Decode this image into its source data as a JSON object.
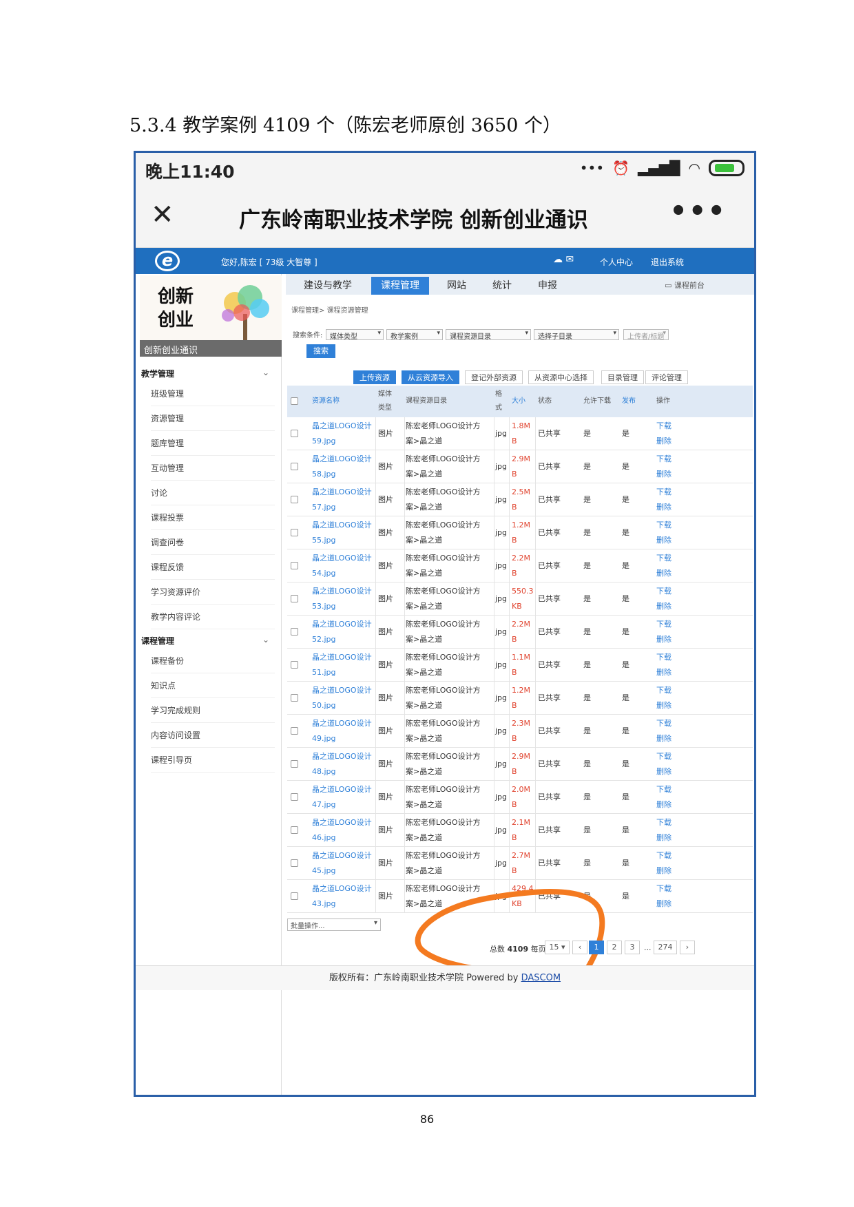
{
  "heading": "5.3.4 教学案例 4109 个（陈宏老师原创 3650 个）",
  "status": {
    "time": "晚上11:40",
    "icons": [
      "more-dots",
      "alarm-icon",
      "signal-icon",
      "wifi-icon",
      "battery-icon"
    ]
  },
  "titlebar": {
    "close": "✕",
    "title": "广东岭南职业技术学院 创新创业通识",
    "more": "•••"
  },
  "topbar": {
    "greeting": "您好,陈宏 [ 73级 大智尊 ]",
    "personal_center": "个人中心",
    "logout": "退出系统"
  },
  "brand": {
    "title_line1": "创新",
    "title_line2": "创业",
    "caption": "创新创业通识"
  },
  "sidebar": {
    "section1": "教学管理",
    "items1": [
      "班级管理",
      "资源管理",
      "题库管理",
      "互动管理",
      "讨论",
      "课程投票",
      "调查问卷",
      "课程反馈",
      "学习资源评价",
      "教学内容评论"
    ],
    "section2": "课程管理",
    "items2": [
      "课程备份",
      "知识点",
      "学习完成规则",
      "内容访问设置",
      "课程引导页"
    ]
  },
  "tabs": {
    "items": [
      "建设与教学",
      "课程管理",
      "网站",
      "统计",
      "申报"
    ],
    "active": "课程管理",
    "front": "课程前台"
  },
  "breadcrumb": "课程管理> 课程资源管理",
  "search": {
    "label": "搜索条件:",
    "media_type": "媒体类型",
    "case": "教学案例",
    "dir": "课程资源目录",
    "subdir": "选择子目录",
    "uploader_placeholder": "上传者/标题",
    "button": "搜索"
  },
  "actions": {
    "upload": "上传资源",
    "import_cloud": "从云资源导入",
    "register_external": "登记外部资源",
    "select_center": "从资源中心选择",
    "dir_manage": "目录管理",
    "comment_manage": "评论管理"
  },
  "table": {
    "headers": {
      "name": "资源名称",
      "media": "媒体类型",
      "dir": "课程资源目录",
      "format": "格式",
      "size": "大小",
      "state": "状态",
      "download": "允许下载",
      "publish": "发布",
      "ops": "操作"
    },
    "rows": [
      {
        "name1": "晶之道LOGO设计",
        "name2": "59.jpg",
        "media": "图片",
        "dir1": "陈宏老师LOGO设计方",
        "dir2": "案>晶之道",
        "format": "jpg",
        "size1": "1.8M",
        "size2": "B",
        "state": "已共享",
        "download": "是",
        "publish": "是",
        "op1": "下载",
        "op2": "删除"
      },
      {
        "name1": "晶之道LOGO设计",
        "name2": "58.jpg",
        "media": "图片",
        "dir1": "陈宏老师LOGO设计方",
        "dir2": "案>晶之道",
        "format": "jpg",
        "size1": "2.9M",
        "size2": "B",
        "state": "已共享",
        "download": "是",
        "publish": "是",
        "op1": "下载",
        "op2": "删除"
      },
      {
        "name1": "晶之道LOGO设计",
        "name2": "57.jpg",
        "media": "图片",
        "dir1": "陈宏老师LOGO设计方",
        "dir2": "案>晶之道",
        "format": "jpg",
        "size1": "2.5M",
        "size2": "B",
        "state": "已共享",
        "download": "是",
        "publish": "是",
        "op1": "下载",
        "op2": "删除"
      },
      {
        "name1": "晶之道LOGO设计",
        "name2": "55.jpg",
        "media": "图片",
        "dir1": "陈宏老师LOGO设计方",
        "dir2": "案>晶之道",
        "format": "jpg",
        "size1": "1.2M",
        "size2": "B",
        "state": "已共享",
        "download": "是",
        "publish": "是",
        "op1": "下载",
        "op2": "删除"
      },
      {
        "name1": "晶之道LOGO设计",
        "name2": "54.jpg",
        "media": "图片",
        "dir1": "陈宏老师LOGO设计方",
        "dir2": "案>晶之道",
        "format": "jpg",
        "size1": "2.2M",
        "size2": "B",
        "state": "已共享",
        "download": "是",
        "publish": "是",
        "op1": "下载",
        "op2": "删除"
      },
      {
        "name1": "晶之道LOGO设计",
        "name2": "53.jpg",
        "media": "图片",
        "dir1": "陈宏老师LOGO设计方",
        "dir2": "案>晶之道",
        "format": "jpg",
        "size1": "550.3",
        "size2": "KB",
        "state": "已共享",
        "download": "是",
        "publish": "是",
        "op1": "下载",
        "op2": "删除"
      },
      {
        "name1": "晶之道LOGO设计",
        "name2": "52.jpg",
        "media": "图片",
        "dir1": "陈宏老师LOGO设计方",
        "dir2": "案>晶之道",
        "format": "jpg",
        "size1": "2.2M",
        "size2": "B",
        "state": "已共享",
        "download": "是",
        "publish": "是",
        "op1": "下载",
        "op2": "删除"
      },
      {
        "name1": "晶之道LOGO设计",
        "name2": "51.jpg",
        "media": "图片",
        "dir1": "陈宏老师LOGO设计方",
        "dir2": "案>晶之道",
        "format": "jpg",
        "size1": "1.1M",
        "size2": "B",
        "state": "已共享",
        "download": "是",
        "publish": "是",
        "op1": "下载",
        "op2": "删除"
      },
      {
        "name1": "晶之道LOGO设计",
        "name2": "50.jpg",
        "media": "图片",
        "dir1": "陈宏老师LOGO设计方",
        "dir2": "案>晶之道",
        "format": "jpg",
        "size1": "1.2M",
        "size2": "B",
        "state": "已共享",
        "download": "是",
        "publish": "是",
        "op1": "下载",
        "op2": "删除"
      },
      {
        "name1": "晶之道LOGO设计",
        "name2": "49.jpg",
        "media": "图片",
        "dir1": "陈宏老师LOGO设计方",
        "dir2": "案>晶之道",
        "format": "jpg",
        "size1": "2.3M",
        "size2": "B",
        "state": "已共享",
        "download": "是",
        "publish": "是",
        "op1": "下载",
        "op2": "删除"
      },
      {
        "name1": "晶之道LOGO设计",
        "name2": "48.jpg",
        "media": "图片",
        "dir1": "陈宏老师LOGO设计方",
        "dir2": "案>晶之道",
        "format": "jpg",
        "size1": "2.9M",
        "size2": "B",
        "state": "已共享",
        "download": "是",
        "publish": "是",
        "op1": "下载",
        "op2": "删除"
      },
      {
        "name1": "晶之道LOGO设计",
        "name2": "47.jpg",
        "media": "图片",
        "dir1": "陈宏老师LOGO设计方",
        "dir2": "案>晶之道",
        "format": "jpg",
        "size1": "2.0M",
        "size2": "B",
        "state": "已共享",
        "download": "是",
        "publish": "是",
        "op1": "下载",
        "op2": "删除"
      },
      {
        "name1": "晶之道LOGO设计",
        "name2": "46.jpg",
        "media": "图片",
        "dir1": "陈宏老师LOGO设计方",
        "dir2": "案>晶之道",
        "format": "jpg",
        "size1": "2.1M",
        "size2": "B",
        "state": "已共享",
        "download": "是",
        "publish": "是",
        "op1": "下载",
        "op2": "删除"
      },
      {
        "name1": "晶之道LOGO设计",
        "name2": "45.jpg",
        "media": "图片",
        "dir1": "陈宏老师LOGO设计方",
        "dir2": "案>晶之道",
        "format": "jpg",
        "size1": "2.7M",
        "size2": "B",
        "state": "已共享",
        "download": "是",
        "publish": "是",
        "op1": "下载",
        "op2": "删除"
      },
      {
        "name1": "晶之道LOGO设计",
        "name2": "43.jpg",
        "media": "图片",
        "dir1": "陈宏老师LOGO设计方",
        "dir2": "案>晶之道",
        "format": "jpg",
        "size1": "429.4",
        "size2": "KB",
        "state": "已共享",
        "download": "是",
        "publish": "是",
        "op1": "下载",
        "op2": "删除"
      }
    ]
  },
  "batch": "批量操作...",
  "pager": {
    "total_label": "总数",
    "total": "4109",
    "per_page_label": "每页",
    "per_page": "15",
    "prev": "‹",
    "pages": [
      "1",
      "2",
      "3"
    ],
    "ellipsis": "...",
    "last": "274",
    "next": "›"
  },
  "footer": {
    "text": "版权所有：广东岭南职业技术学院 Powered by",
    "link": "DASCOM"
  },
  "page_number": "86",
  "colors": {
    "accent": "#2f80d8",
    "topbar": "#1f6fbf",
    "highlight_circle": "#f47a20",
    "size_text": "#e0432e"
  }
}
